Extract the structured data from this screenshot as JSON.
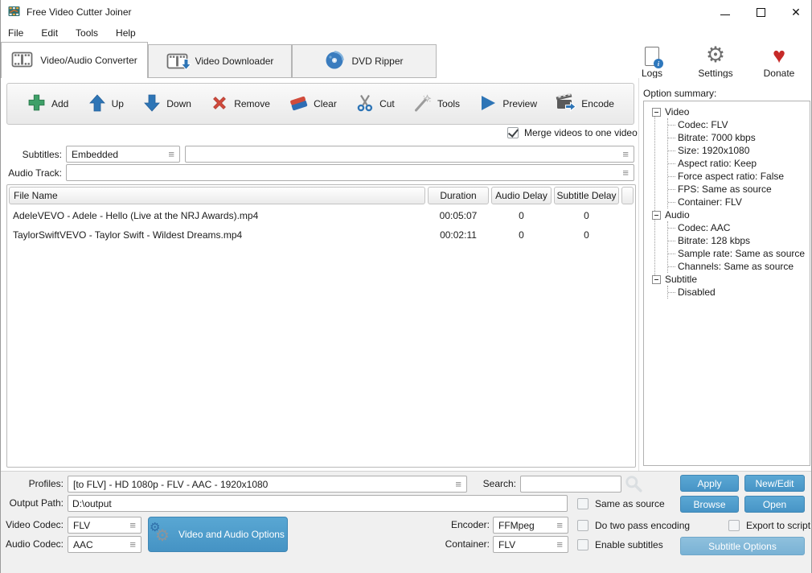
{
  "window": {
    "title": "Free Video Cutter Joiner"
  },
  "menu": {
    "items": [
      "File",
      "Edit",
      "Tools",
      "Help"
    ]
  },
  "tabs": [
    {
      "label": "Video/Audio Converter",
      "active": true
    },
    {
      "label": "Video Downloader",
      "active": false
    },
    {
      "label": "DVD Ripper",
      "active": false
    }
  ],
  "header_actions": {
    "logs": "Logs",
    "settings": "Settings",
    "donate": "Donate"
  },
  "toolbar": {
    "add": "Add",
    "up": "Up",
    "down": "Down",
    "remove": "Remove",
    "clear": "Clear",
    "cut": "Cut",
    "tools": "Tools",
    "preview": "Preview",
    "encode": "Encode",
    "merge_label": "Merge videos to one video",
    "merge_checked": true
  },
  "fields": {
    "subtitles_label": "Subtitles:",
    "subtitles_value": "Embedded",
    "subtitles_extra_value": "",
    "audio_track_label": "Audio Track:",
    "audio_track_value": ""
  },
  "file_table": {
    "columns": [
      "File Name",
      "Duration",
      "Audio Delay",
      "Subtitle Delay"
    ],
    "rows": [
      [
        "AdeleVEVO - Adele - Hello (Live at the NRJ Awards).mp4",
        "00:05:07",
        "0",
        "0"
      ],
      [
        "TaylorSwiftVEVO - Taylor Swift - Wildest Dreams.mp4",
        "00:02:11",
        "0",
        "0"
      ]
    ]
  },
  "option_summary": {
    "label": "Option summary:",
    "tree": [
      {
        "label": "Video",
        "children": [
          "Codec: FLV",
          "Bitrate: 7000 kbps",
          "Size: 1920x1080",
          "Aspect ratio: Keep",
          "Force aspect ratio: False",
          "FPS: Same as source",
          "Container: FLV"
        ]
      },
      {
        "label": "Audio",
        "children": [
          "Codec: AAC",
          "Bitrate: 128 kbps",
          "Sample rate: Same as source",
          "Channels: Same as source"
        ]
      },
      {
        "label": "Subtitle",
        "children": [
          "Disabled"
        ]
      }
    ]
  },
  "bottom": {
    "profiles_label": "Profiles:",
    "profiles_value": "[to FLV] - HD 1080p - FLV - AAC - 1920x1080",
    "search_label": "Search:",
    "search_value": "",
    "output_path_label": "Output Path:",
    "output_path_value": "D:\\output",
    "video_codec_label": "Video Codec:",
    "video_codec_value": "FLV",
    "audio_codec_label": "Audio Codec:",
    "audio_codec_value": "AAC",
    "encoder_label": "Encoder:",
    "encoder_value": "FFMpeg",
    "container_label": "Container:",
    "container_value": "FLV",
    "video_audio_options_label": "Video and Audio Options",
    "checkboxes": {
      "same_as_source": {
        "label": "Same as source",
        "checked": false
      },
      "two_pass": {
        "label": "Do two pass encoding",
        "checked": false
      },
      "enable_subtitles": {
        "label": "Enable subtitles",
        "checked": false
      },
      "export_script": {
        "label": "Export to script",
        "checked": false
      }
    },
    "buttons": {
      "apply": "Apply",
      "new_edit": "New/Edit",
      "browse": "Browse",
      "open": "Open",
      "subtitle_options": "Subtitle Options"
    }
  },
  "colors": {
    "accent_blue": "#4a97c7",
    "accent_blue_light": "#7fb6d9",
    "heart_red": "#c62a28",
    "gear_gray": "#6e6e6e"
  }
}
